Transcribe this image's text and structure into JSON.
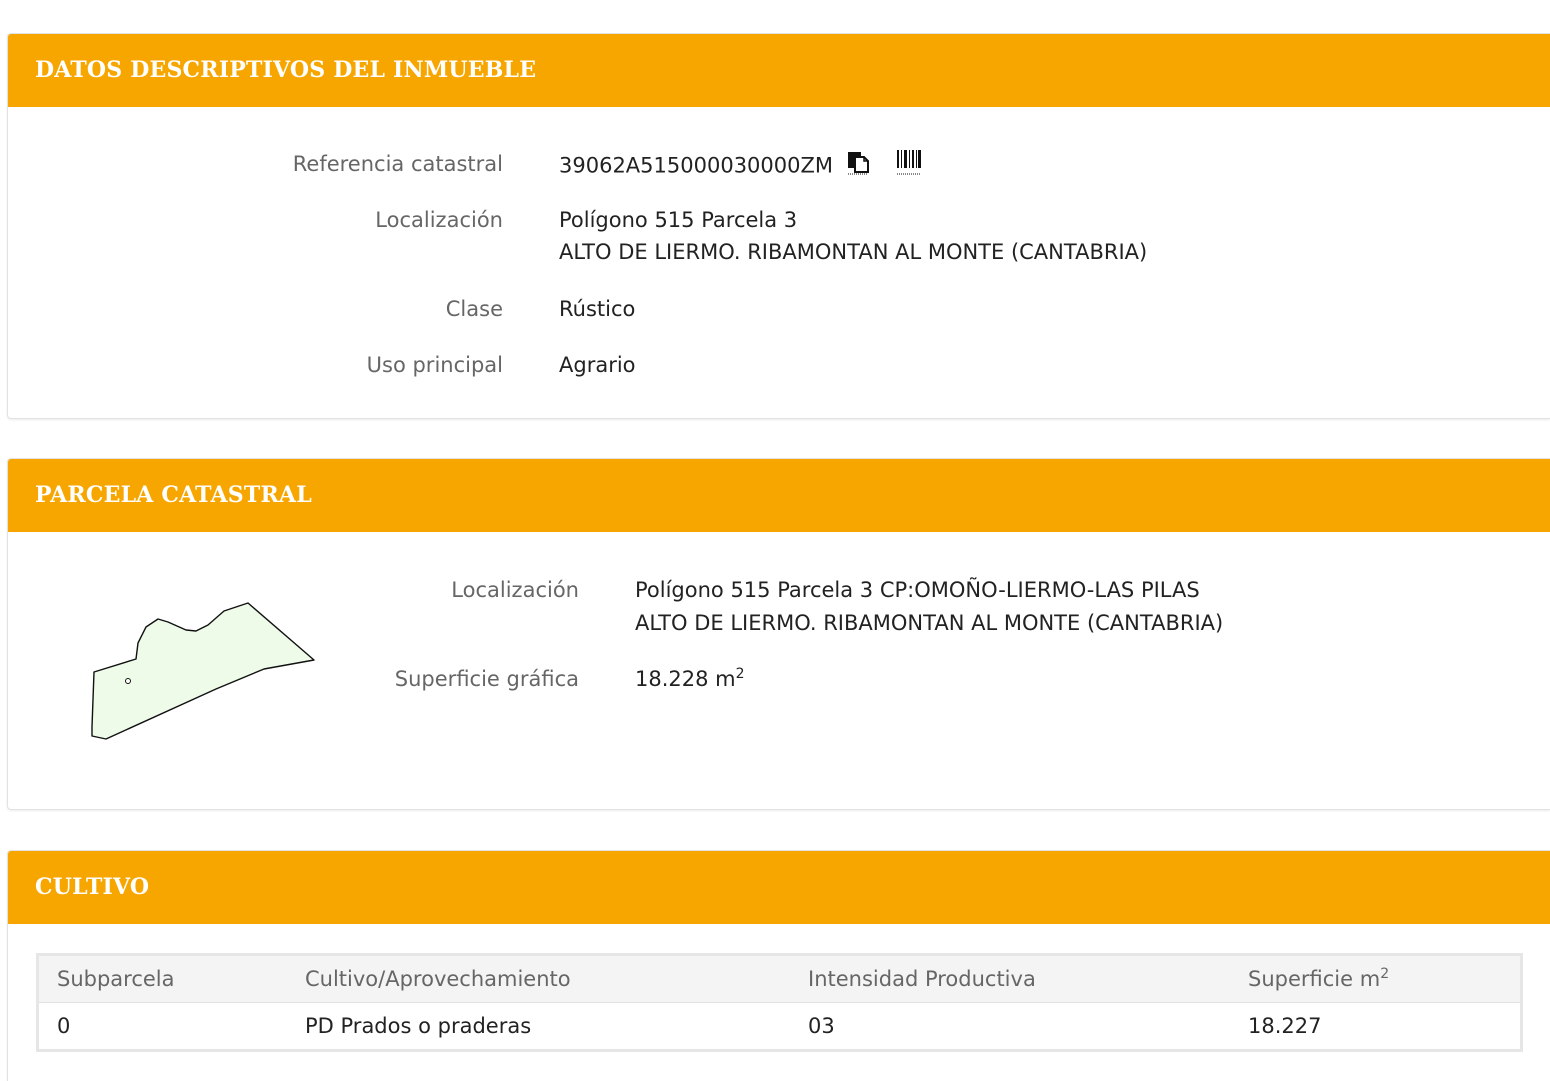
{
  "datos": {
    "header": "DATOS DESCRIPTIVOS DEL INMUEBLE",
    "ref_label": "Referencia catastral",
    "ref_value": "39062A515000030000ZM",
    "loc_label": "Localización",
    "loc_line1": "Polígono 515 Parcela 3",
    "loc_line2": "ALTO DE LIERMO. RIBAMONTAN AL MONTE (CANTABRIA)",
    "clase_label": "Clase",
    "clase_value": "Rústico",
    "uso_label": "Uso principal",
    "uso_value": "Agrario"
  },
  "parcela": {
    "header": "PARCELA CATASTRAL",
    "loc_label": "Localización",
    "loc_line1": "Polígono 515 Parcela 3 CP:OMOÑO-LIERMO-LAS PILAS",
    "loc_line2": "ALTO DE LIERMO. RIBAMONTAN AL MONTE (CANTABRIA)",
    "sup_label": "Superficie gráfica",
    "sup_value": "18.228 m",
    "sup_unit_exp": "2"
  },
  "cultivo": {
    "header": "CULTIVO",
    "columns": [
      "Subparcela",
      "Cultivo/Aprovechamiento",
      "Intensidad Productiva",
      "Superficie m"
    ],
    "sup_col_exp": "2",
    "rows": [
      [
        "0",
        "PD Prados o praderas",
        "03",
        "18.227"
      ]
    ]
  },
  "colors": {
    "header_bg": "#F7A600",
    "parcel_fill": "#EEFBE8"
  },
  "icons": [
    "copy-icon",
    "barcode-icon"
  ]
}
